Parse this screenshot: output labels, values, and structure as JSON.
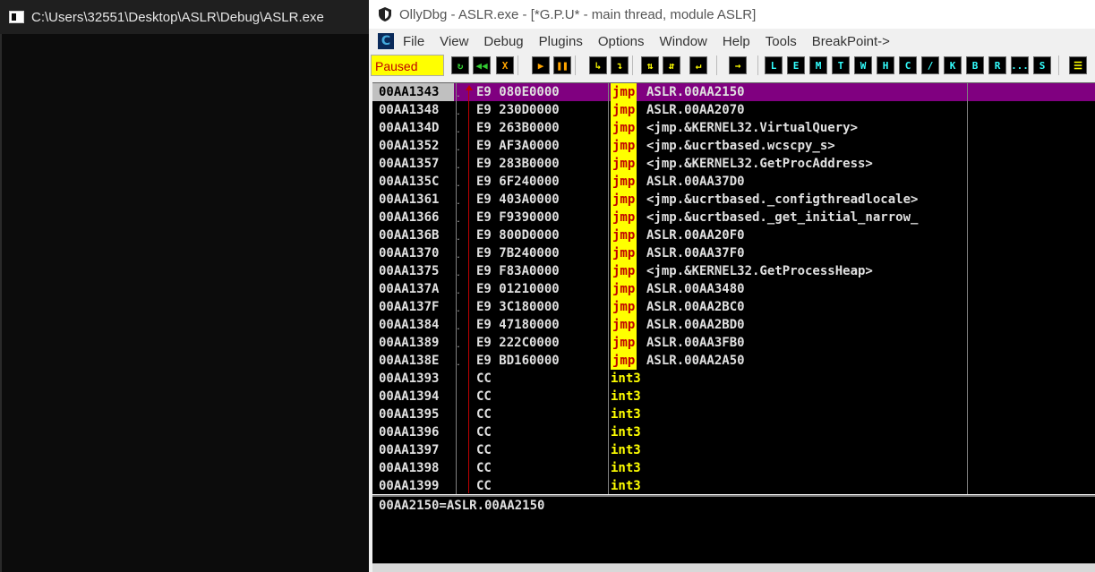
{
  "console": {
    "title": "C:\\Users\\32551\\Desktop\\ASLR\\Debug\\ASLR.exe"
  },
  "ollydbg": {
    "title": "OllyDbg - ASLR.exe - [*G.P.U* - main thread, module ASLR]",
    "menu_icon_letter": "C",
    "menu": [
      "File",
      "View",
      "Debug",
      "Plugins",
      "Options",
      "Window",
      "Help",
      "Tools",
      "BreakPoint->"
    ],
    "status": "Paused",
    "toolbar_letters": [
      "L",
      "E",
      "M",
      "T",
      "W",
      "H",
      "C",
      "/",
      "K",
      "B",
      "R",
      "...",
      "S"
    ],
    "rows": [
      {
        "addr": "00AA1343",
        "hex": "E9 080E0000",
        "mnem": "jmp",
        "args": "ASLR.00AA2150",
        "selected": true
      },
      {
        "addr": "00AA1348",
        "hex": "E9 230D0000",
        "mnem": "jmp",
        "args": "ASLR.00AA2070"
      },
      {
        "addr": "00AA134D",
        "hex": "E9 263B0000",
        "mnem": "jmp",
        "args": "<jmp.&KERNEL32.VirtualQuery>"
      },
      {
        "addr": "00AA1352",
        "hex": "E9 AF3A0000",
        "mnem": "jmp",
        "args": "<jmp.&ucrtbased.wcscpy_s>"
      },
      {
        "addr": "00AA1357",
        "hex": "E9 283B0000",
        "mnem": "jmp",
        "args": "<jmp.&KERNEL32.GetProcAddress>"
      },
      {
        "addr": "00AA135C",
        "hex": "E9 6F240000",
        "mnem": "jmp",
        "args": "ASLR.00AA37D0"
      },
      {
        "addr": "00AA1361",
        "hex": "E9 403A0000",
        "mnem": "jmp",
        "args": "<jmp.&ucrtbased._configthreadlocale>"
      },
      {
        "addr": "00AA1366",
        "hex": "E9 F9390000",
        "mnem": "jmp",
        "args": "<jmp.&ucrtbased._get_initial_narrow_"
      },
      {
        "addr": "00AA136B",
        "hex": "E9 800D0000",
        "mnem": "jmp",
        "args": "ASLR.00AA20F0"
      },
      {
        "addr": "00AA1370",
        "hex": "E9 7B240000",
        "mnem": "jmp",
        "args": "ASLR.00AA37F0"
      },
      {
        "addr": "00AA1375",
        "hex": "E9 F83A0000",
        "mnem": "jmp",
        "args": "<jmp.&KERNEL32.GetProcessHeap>"
      },
      {
        "addr": "00AA137A",
        "hex": "E9 01210000",
        "mnem": "jmp",
        "args": "ASLR.00AA3480"
      },
      {
        "addr": "00AA137F",
        "hex": "E9 3C180000",
        "mnem": "jmp",
        "args": "ASLR.00AA2BC0"
      },
      {
        "addr": "00AA1384",
        "hex": "E9 47180000",
        "mnem": "jmp",
        "args": "ASLR.00AA2BD0"
      },
      {
        "addr": "00AA1389",
        "hex": "E9 222C0000",
        "mnem": "jmp",
        "args": "ASLR.00AA3FB0"
      },
      {
        "addr": "00AA138E",
        "hex": "E9 BD160000",
        "mnem": "jmp",
        "args": "ASLR.00AA2A50"
      },
      {
        "addr": "00AA1393",
        "hex": "CC",
        "mnem": "int3",
        "args": ""
      },
      {
        "addr": "00AA1394",
        "hex": "CC",
        "mnem": "int3",
        "args": ""
      },
      {
        "addr": "00AA1395",
        "hex": "CC",
        "mnem": "int3",
        "args": ""
      },
      {
        "addr": "00AA1396",
        "hex": "CC",
        "mnem": "int3",
        "args": ""
      },
      {
        "addr": "00AA1397",
        "hex": "CC",
        "mnem": "int3",
        "args": ""
      },
      {
        "addr": "00AA1398",
        "hex": "CC",
        "mnem": "int3",
        "args": ""
      },
      {
        "addr": "00AA1399",
        "hex": "CC",
        "mnem": "int3",
        "args": ""
      }
    ],
    "info": "00AA2150=ASLR.00AA2150"
  },
  "colors": {
    "selected_row": "#800080",
    "jmp_bg": "#ffff00",
    "jmp_fg": "#c00000",
    "int3": "#ffff00",
    "status_bg": "#ffff00",
    "status_fg": "#c00000"
  }
}
